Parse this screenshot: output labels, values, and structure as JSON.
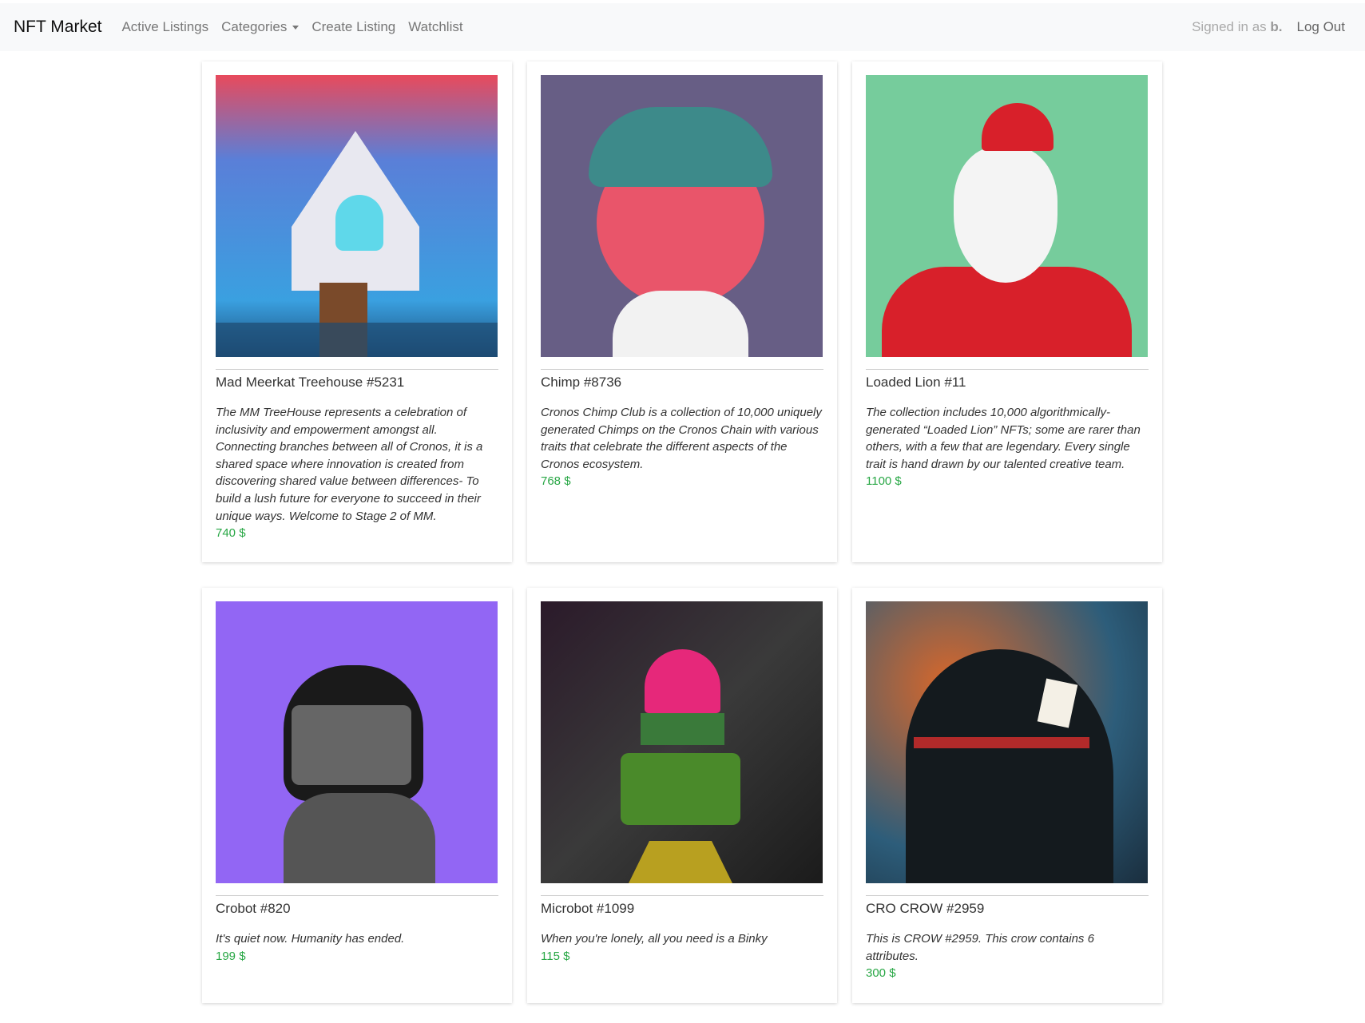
{
  "nav": {
    "brand": "NFT Market",
    "links": [
      "Active Listings",
      "Categories",
      "Create Listing",
      "Watchlist"
    ],
    "signed_in_prefix": "Signed in as",
    "username": "b.",
    "logout": "Log Out"
  },
  "listings": [
    {
      "title": "Mad Meerkat Treehouse #5231",
      "description": "The MM TreeHouse represents a celebration of inclusivity and empowerment amongst all. Connecting branches between all of Cronos, it is a shared space where innovation is created from discovering shared value between differences- To build a lush future for everyone to succeed in their unique ways. Welcome to Stage 2 of MM.",
      "price": "740 $"
    },
    {
      "title": "Chimp #8736",
      "description": "Cronos Chimp Club is a collection of 10,000 uniquely generated Chimps on the Cronos Chain with various traits that celebrate the different aspects of the Cronos ecosystem.",
      "price": "768 $"
    },
    {
      "title": "Loaded Lion #11",
      "description": "The collection includes 10,000 algorithmically-generated “Loaded Lion” NFTs; some are rarer than others, with a few that are legendary. Every single trait is hand drawn by our talented creative team.",
      "price": "1100 $"
    },
    {
      "title": "Crobot #820",
      "description": "It's quiet now. Humanity has ended.",
      "price": "199 $"
    },
    {
      "title": "Microbot #1099",
      "description": "When you're lonely, all you need is a Binky",
      "price": "115 $"
    },
    {
      "title": "CRO CROW #2959",
      "description": "This is CROW #2959. This crow contains 6 attributes.",
      "price": "300 $"
    }
  ],
  "colors": {
    "price": "#28a745",
    "navbar_bg": "#f8f9fa"
  }
}
